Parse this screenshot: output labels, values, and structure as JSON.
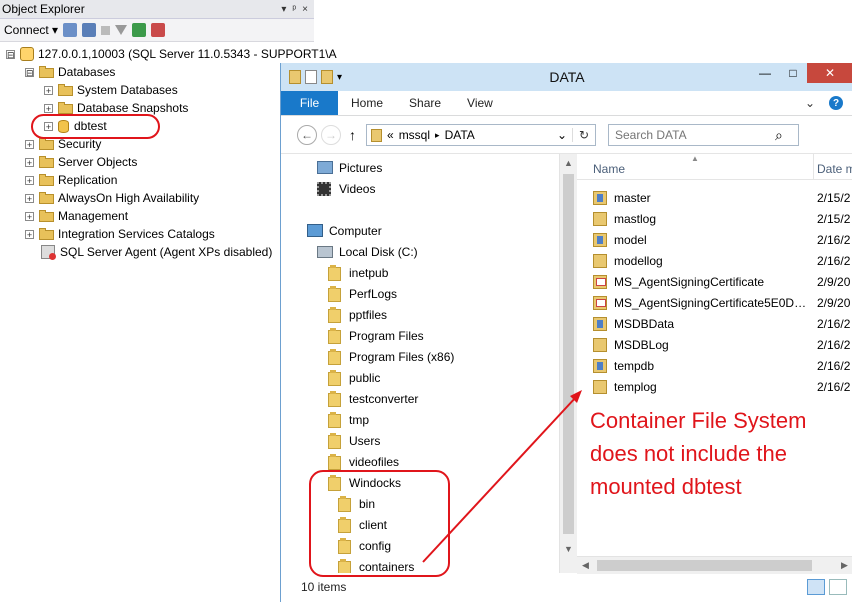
{
  "object_explorer": {
    "title": "Object Explorer",
    "title_controls": [
      "▾",
      "ᵖ",
      "×"
    ],
    "connect_label": "Connect ▾",
    "tree": [
      {
        "label": "127.0.0.1,10003 (SQL Server 11.0.5343 - SUPPORT1\\A",
        "expander": "⊟",
        "icon": "server-icon"
      },
      {
        "label": "Databases",
        "expander": "⊟",
        "icon": "folder-icon"
      },
      {
        "label": "System Databases",
        "expander": "+",
        "icon": "folder-icon"
      },
      {
        "label": "Database Snapshots",
        "expander": "+",
        "icon": "folder-icon"
      },
      {
        "label": "dbtest",
        "expander": "+",
        "icon": "database-icon"
      },
      {
        "label": "Security",
        "expander": "+",
        "icon": "folder-icon"
      },
      {
        "label": "Server Objects",
        "expander": "+",
        "icon": "folder-icon"
      },
      {
        "label": "Replication",
        "expander": "+",
        "icon": "folder-icon"
      },
      {
        "label": "AlwaysOn High Availability",
        "expander": "+",
        "icon": "folder-icon"
      },
      {
        "label": "Management",
        "expander": "+",
        "icon": "folder-icon"
      },
      {
        "label": "Integration Services Catalogs",
        "expander": "+",
        "icon": "folder-icon"
      },
      {
        "label": "SQL Server Agent (Agent XPs disabled)",
        "expander": "",
        "icon": "sql-agent-icon"
      }
    ]
  },
  "explorer": {
    "title": "DATA",
    "win_controls": {
      "minimize": "—",
      "maximize": "□",
      "close": "✕"
    },
    "ribbon_tabs": [
      "File",
      "Home",
      "Share",
      "View"
    ],
    "ribbon_options": [
      "⌄",
      "?"
    ],
    "nav_back": "←",
    "nav_forward": "→",
    "nav_up": "↑",
    "address": {
      "prefix": "«",
      "crumb1": "mssql",
      "sep": "▸",
      "crumb2": "DATA",
      "dropdown": "⌄",
      "refresh": "↻"
    },
    "search": {
      "placeholder": "Search DATA",
      "icon": "⌕"
    },
    "nav_items": [
      {
        "label": "Pictures",
        "icon": "pictures-icon"
      },
      {
        "label": "Videos",
        "icon": "videos-icon"
      },
      {
        "label": "Computer",
        "icon": "computer-icon"
      },
      {
        "label": "Local Disk (C:)",
        "icon": "disk-icon"
      },
      {
        "label": "inetpub",
        "icon": "folder-icon"
      },
      {
        "label": "PerfLogs",
        "icon": "folder-icon"
      },
      {
        "label": "pptfiles",
        "icon": "folder-icon"
      },
      {
        "label": "Program Files",
        "icon": "folder-icon"
      },
      {
        "label": "Program Files (x86)",
        "icon": "folder-icon"
      },
      {
        "label": "public",
        "icon": "folder-icon"
      },
      {
        "label": "testconverter",
        "icon": "folder-icon"
      },
      {
        "label": "tmp",
        "icon": "folder-icon"
      },
      {
        "label": "Users",
        "icon": "folder-icon"
      },
      {
        "label": "videofiles",
        "icon": "folder-icon"
      },
      {
        "label": "Windocks",
        "icon": "folder-icon"
      },
      {
        "label": "bin",
        "icon": "folder-icon"
      },
      {
        "label": "client",
        "icon": "folder-icon"
      },
      {
        "label": "config",
        "icon": "folder-icon"
      },
      {
        "label": "containers",
        "icon": "folder-icon"
      }
    ],
    "columns": {
      "name": "Name",
      "date": "Date m"
    },
    "files": [
      {
        "name": "master",
        "date": "2/15/2",
        "type": "db"
      },
      {
        "name": "mastlog",
        "date": "2/15/2",
        "type": "log"
      },
      {
        "name": "model",
        "date": "2/16/2",
        "type": "db"
      },
      {
        "name": "modellog",
        "date": "2/16/2",
        "type": "log"
      },
      {
        "name": "MS_AgentSigningCertificate",
        "date": "2/9/20",
        "type": "cert"
      },
      {
        "name": "MS_AgentSigningCertificate5E0D…",
        "date": "2/9/20",
        "type": "cert"
      },
      {
        "name": "MSDBData",
        "date": "2/16/2",
        "type": "db"
      },
      {
        "name": "MSDBLog",
        "date": "2/16/2",
        "type": "log"
      },
      {
        "name": "tempdb",
        "date": "2/16/2",
        "type": "db"
      },
      {
        "name": "templog",
        "date": "2/16/2",
        "type": "log"
      }
    ],
    "status": "10 items"
  },
  "annotation": {
    "text": "Container File System does not include the mounted dbtest",
    "color": "#e0151b"
  },
  "colors": {
    "accent": "#1979ca",
    "titlebar": "#cde3f5",
    "annotation": "#e0151b"
  }
}
